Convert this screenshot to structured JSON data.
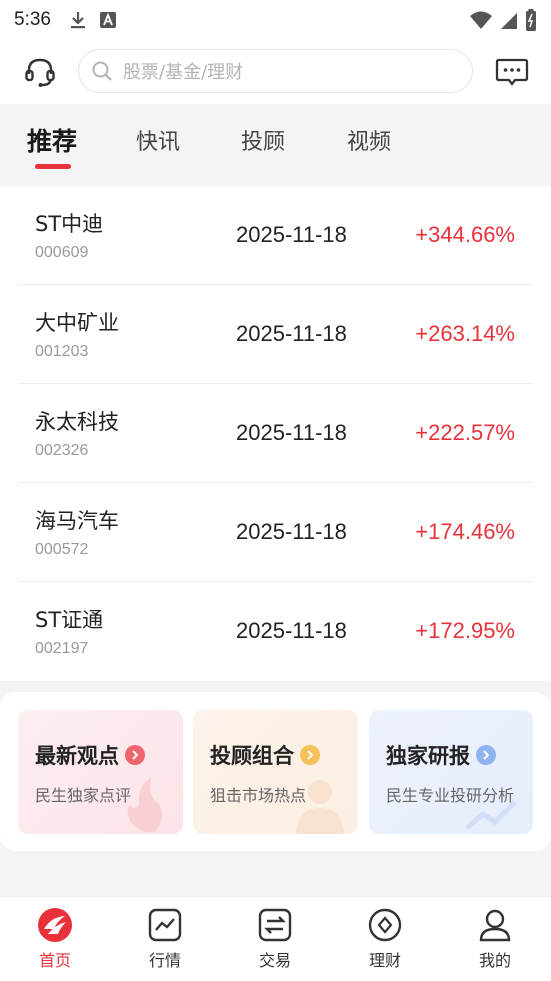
{
  "status_bar": {
    "time": "5:36"
  },
  "header": {
    "search_placeholder": "股票/基金/理财"
  },
  "tabs": [
    {
      "label": "推荐",
      "active": true
    },
    {
      "label": "快讯",
      "active": false
    },
    {
      "label": "投顾",
      "active": false
    },
    {
      "label": "视频",
      "active": false
    }
  ],
  "stocks": [
    {
      "name": "ST中迪",
      "code": "000609",
      "date": "2025-11-18",
      "change": "+344.66%"
    },
    {
      "name": "大中矿业",
      "code": "001203",
      "date": "2025-11-18",
      "change": "+263.14%"
    },
    {
      "name": "永太科技",
      "code": "002326",
      "date": "2025-11-18",
      "change": "+222.57%"
    },
    {
      "name": "海马汽车",
      "code": "000572",
      "date": "2025-11-18",
      "change": "+174.46%"
    },
    {
      "name": "ST证通",
      "code": "002197",
      "date": "2025-11-18",
      "change": "+172.95%"
    }
  ],
  "feature_cards": [
    {
      "title": "最新观点",
      "subtitle": "民生独家点评",
      "arrow_color": "#f0646e"
    },
    {
      "title": "投顾组合",
      "subtitle": "狙击市场热点",
      "arrow_color": "#f5c25a"
    },
    {
      "title": "独家研报",
      "subtitle": "民生专业投研分析",
      "arrow_color": "#8fb2f0"
    }
  ],
  "bottom_nav": [
    {
      "label": "首页",
      "icon": "home-logo-icon",
      "active": true
    },
    {
      "label": "行情",
      "icon": "market-chart-icon",
      "active": false
    },
    {
      "label": "交易",
      "icon": "trade-exchange-icon",
      "active": false
    },
    {
      "label": "理财",
      "icon": "wealth-diamond-icon",
      "active": false
    },
    {
      "label": "我的",
      "icon": "profile-icon",
      "active": false
    }
  ],
  "colors": {
    "accent": "#e8323a",
    "rise": "#e8323a"
  }
}
